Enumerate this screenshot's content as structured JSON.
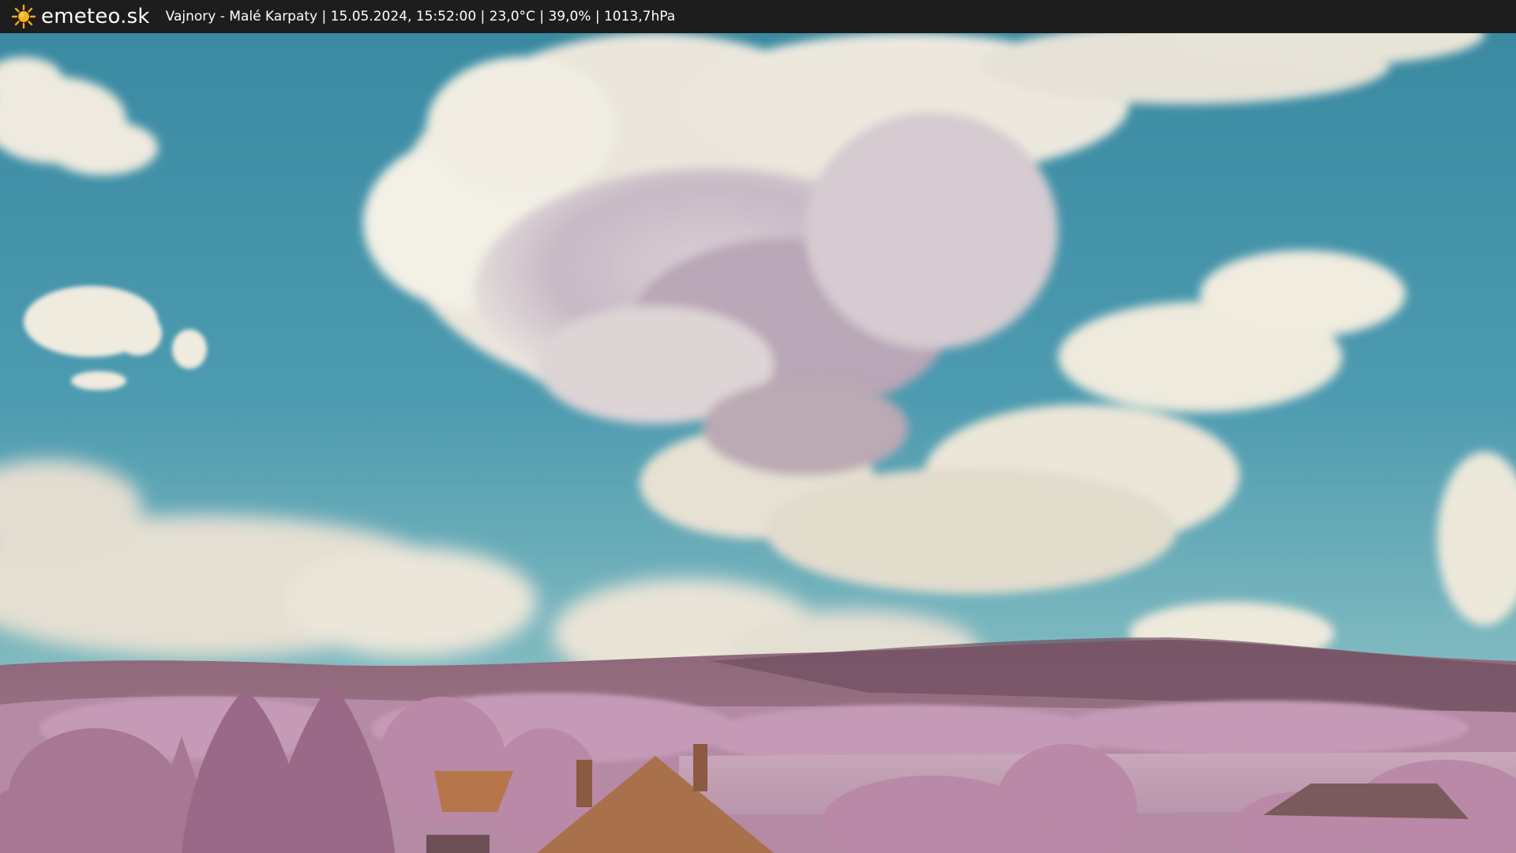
{
  "header": {
    "brand": "emeteo.sk",
    "logo_icon": "sun-icon",
    "caption": "Vajnory - Malé Karpaty | 15.05.2024, 15:52:00 | 23,0°C | 39,0% | 1013,7hPa"
  },
  "colors": {
    "bar": "#1d1d1d",
    "sun": "#f2a81d",
    "sky_top": "#3f8fa6",
    "sky_horizon": "#86c2c4",
    "foliage": "#b98aa8",
    "hills": "#8c6577",
    "roof": "#b5764c"
  }
}
